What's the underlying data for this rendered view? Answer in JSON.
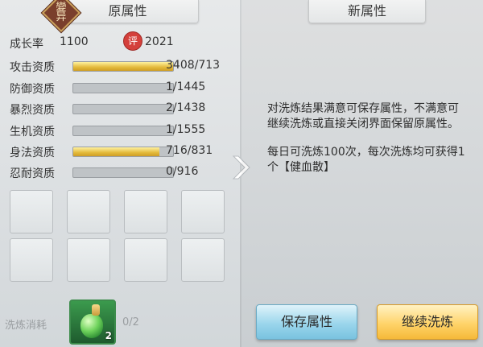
{
  "tabs": {
    "original": "原属性",
    "new": "新属性"
  },
  "badge": {
    "text": "變异"
  },
  "growth": {
    "label": "成长率",
    "value": "1100",
    "score_icon": "评",
    "score": "2021"
  },
  "stats": [
    {
      "label": "攻击资质",
      "value": "3408/713",
      "fill": 1.0
    },
    {
      "label": "防御资质",
      "value": "1/1445",
      "fill": 0.0
    },
    {
      "label": "暴烈资质",
      "value": "2/1438",
      "fill": 0.0
    },
    {
      "label": "生机资质",
      "value": "1/1555",
      "fill": 0.0
    },
    {
      "label": "身法资质",
      "value": "716/831",
      "fill": 0.86
    },
    {
      "label": "忍耐资质",
      "value": "0/916",
      "fill": 0.0
    }
  ],
  "description": {
    "line1": "对洗炼结果满意可保存属性，不满意可继续洗炼或直接关闭界面保留原属性。",
    "line2": "每日可洗炼100次，每次洗炼均可获得1个【健血散】"
  },
  "cost": {
    "label": "洗炼消耗",
    "item_count": "2",
    "usage": "0/2"
  },
  "buttons": {
    "save": "保存属性",
    "continue": "继续洗炼"
  }
}
